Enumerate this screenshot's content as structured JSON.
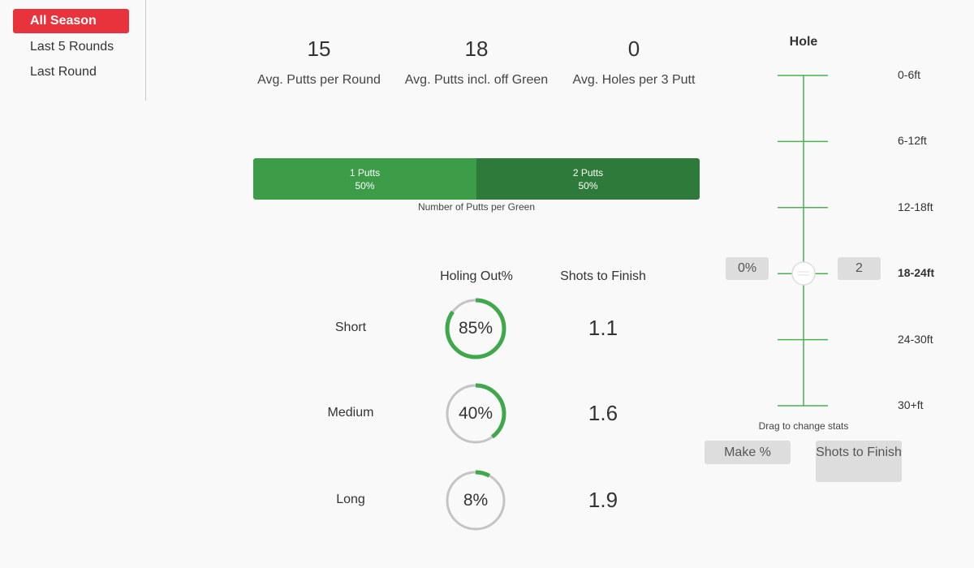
{
  "sidebar": {
    "items": [
      {
        "label": "All Season",
        "active": true
      },
      {
        "label": "Last 5 Rounds"
      },
      {
        "label": "Last Round"
      }
    ]
  },
  "stats": [
    {
      "value": "15",
      "label": "Avg. Putts per Round"
    },
    {
      "value": "18",
      "label": "Avg. Putts incl. off Green"
    },
    {
      "value": "0",
      "label": "Avg. Holes per 3 Putt"
    }
  ],
  "putts_bar": {
    "segments": [
      {
        "label": "1 Putts",
        "pct": "50%",
        "value": 50,
        "color": "#3d9c48"
      },
      {
        "label": "2 Putts",
        "pct": "50%",
        "value": 50,
        "color": "#2e7a3a"
      }
    ],
    "caption": "Number of Putts per Green"
  },
  "table": {
    "headers": {
      "holing": "Holing Out%",
      "shots": "Shots to Finish"
    },
    "rows": [
      {
        "label": "Short",
        "pct": "85%",
        "value": 85,
        "shots": "1.1"
      },
      {
        "label": "Medium",
        "pct": "40%",
        "value": 40,
        "shots": "1.6"
      },
      {
        "label": "Long",
        "pct": "8%",
        "value": 8,
        "shots": "1.9"
      }
    ]
  },
  "slider": {
    "title": "Hole",
    "ticks": [
      "0-6ft",
      "6-12ft",
      "12-18ft",
      "18-24ft",
      "24-30ft",
      "30+ft"
    ],
    "selected": "18-24ft",
    "make_pct": "0%",
    "shots": "2",
    "hint": "Drag to change stats"
  },
  "buttons": {
    "make": "Make %",
    "shots": "Shots to Finish"
  },
  "colors": {
    "accent": "#e8323c",
    "green": "#3ea84a"
  }
}
